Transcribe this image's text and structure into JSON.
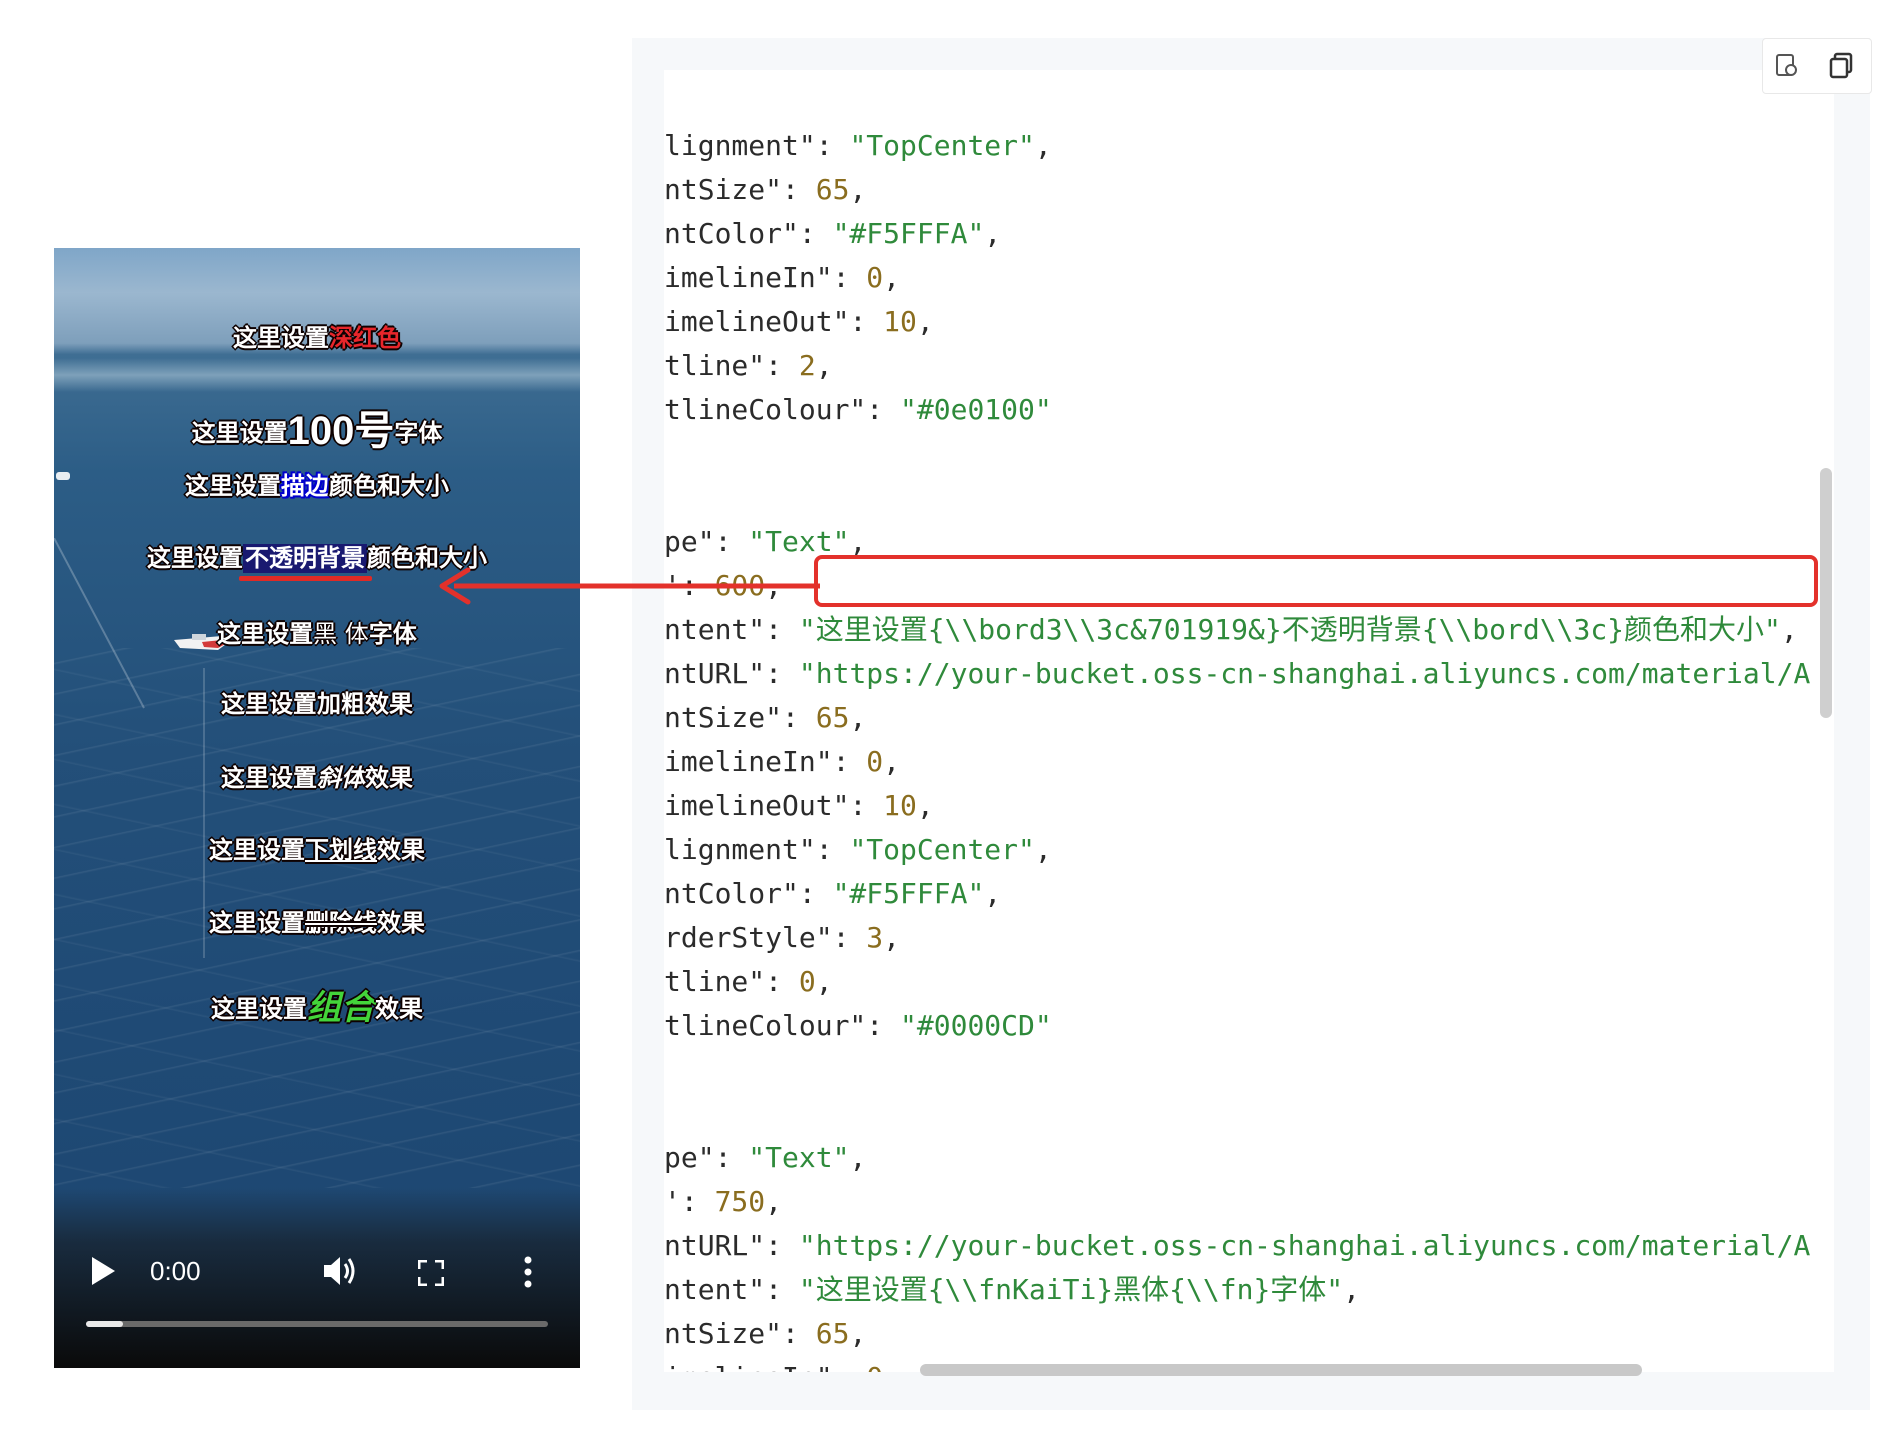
{
  "video": {
    "subtitles": [
      {
        "prefix": "这里设置",
        "highlight": "深红色",
        "suffix": ""
      },
      {
        "prefix": "这里设置",
        "highlight": "100号",
        "suffix": "字体"
      },
      {
        "prefix": "这里设置",
        "highlight": "描边",
        "suffix": "颜色和大小"
      },
      {
        "prefix": "这里设置",
        "highlight": "不透明背景",
        "suffix": "颜色和大小"
      },
      {
        "prefix": "这里设置",
        "highlight": "黑 体",
        "suffix": "字体"
      },
      {
        "prefix": "这里设置",
        "highlight": "加粗",
        "suffix": "效果"
      },
      {
        "prefix": "这里设置",
        "highlight": "斜体",
        "suffix": "效果"
      },
      {
        "prefix": "这里设置",
        "highlight": "下划线",
        "suffix": "效果"
      },
      {
        "prefix": "这里设置",
        "highlight": "删除线",
        "suffix": "效果"
      },
      {
        "prefix": "这里设置",
        "highlight": "组合",
        "suffix": "效果"
      }
    ],
    "controls": {
      "time": "0:00",
      "progress_fraction": 0.08,
      "play_icon": "play-icon",
      "volume_icon": "volume-icon",
      "fullscreen_icon": "fullscreen-icon",
      "more_icon": "more-vertical-icon"
    }
  },
  "code_panel": {
    "toolbar": {
      "refresh_icon": "refresh-icon",
      "copy_icon": "copy-icon"
    },
    "lines": [
      {
        "key": "lignment\"",
        "sep": ": ",
        "value": "\"TopCenter\"",
        "end": ",",
        "vtype": "str"
      },
      {
        "key": "ntSize\"",
        "sep": ": ",
        "value": "65",
        "end": ",",
        "vtype": "num"
      },
      {
        "key": "ntColor\"",
        "sep": ": ",
        "value": "\"#F5FFFA\"",
        "end": ",",
        "vtype": "str"
      },
      {
        "key": "imelineIn\"",
        "sep": ": ",
        "value": "0",
        "end": ",",
        "vtype": "num"
      },
      {
        "key": "imelineOut\"",
        "sep": ": ",
        "value": "10",
        "end": ",",
        "vtype": "num"
      },
      {
        "key": "tline\"",
        "sep": ": ",
        "value": "2",
        "end": ",",
        "vtype": "num"
      },
      {
        "key": "tlineColour\"",
        "sep": ": ",
        "value": "\"#0e0100\"",
        "end": "",
        "vtype": "str"
      },
      {
        "key": "",
        "sep": "",
        "value": "",
        "end": "",
        "vtype": "str"
      },
      {
        "key": "",
        "sep": "",
        "value": "",
        "end": "",
        "vtype": "str"
      },
      {
        "key": "pe\"",
        "sep": ": ",
        "value": "\"Text\"",
        "end": ",",
        "vtype": "str"
      },
      {
        "key": "'",
        "sep": ": ",
        "value": "600",
        "end": ",",
        "vtype": "num"
      },
      {
        "key": "ntent\"",
        "sep": ": ",
        "value": "\"这里设置{\\\\bord3\\\\3c&701919&}不透明背景{\\\\bord\\\\3c}颜色和大小\"",
        "end": ",",
        "vtype": "str"
      },
      {
        "key": "ntURL\"",
        "sep": ": ",
        "value": "\"https://your-bucket.oss-cn-shanghai.aliyuncs.com/material/A",
        "end": "",
        "vtype": "str"
      },
      {
        "key": "ntSize\"",
        "sep": ": ",
        "value": "65",
        "end": ",",
        "vtype": "num"
      },
      {
        "key": "imelineIn\"",
        "sep": ": ",
        "value": "0",
        "end": ",",
        "vtype": "num"
      },
      {
        "key": "imelineOut\"",
        "sep": ": ",
        "value": "10",
        "end": ",",
        "vtype": "num"
      },
      {
        "key": "lignment\"",
        "sep": ": ",
        "value": "\"TopCenter\"",
        "end": ",",
        "vtype": "str"
      },
      {
        "key": "ntColor\"",
        "sep": ": ",
        "value": "\"#F5FFFA\"",
        "end": ",",
        "vtype": "str"
      },
      {
        "key": "rderStyle\"",
        "sep": ": ",
        "value": "3",
        "end": ",",
        "vtype": "num"
      },
      {
        "key": "tline\"",
        "sep": ": ",
        "value": "0",
        "end": ",",
        "vtype": "num"
      },
      {
        "key": "tlineColour\"",
        "sep": ": ",
        "value": "\"#0000CD\"",
        "end": "",
        "vtype": "str"
      },
      {
        "key": "",
        "sep": "",
        "value": "",
        "end": "",
        "vtype": "str"
      },
      {
        "key": "",
        "sep": "",
        "value": "",
        "end": "",
        "vtype": "str"
      },
      {
        "key": "pe\"",
        "sep": ": ",
        "value": "\"Text\"",
        "end": ",",
        "vtype": "str"
      },
      {
        "key": "'",
        "sep": ": ",
        "value": "750",
        "end": ",",
        "vtype": "num"
      },
      {
        "key": "ntURL\"",
        "sep": ": ",
        "value": "\"https://your-bucket.oss-cn-shanghai.aliyuncs.com/material/A",
        "end": "",
        "vtype": "str"
      },
      {
        "key": "ntent\"",
        "sep": ": ",
        "value": "\"这里设置{\\\\fnKaiTi}黑体{\\\\fn}字体\"",
        "end": ",",
        "vtype": "str"
      },
      {
        "key": "ntSize\"",
        "sep": ": ",
        "value": "65",
        "end": ",",
        "vtype": "num"
      },
      {
        "key": "imelineIn\"",
        "sep": ": ",
        "value": "0",
        "end": ",",
        "vtype": "num"
      }
    ]
  },
  "colors": {
    "subtitle_red": "#e8262b",
    "outline_dark": "#0e0100",
    "outline_blue": "#0000CD",
    "box_background": "#191970",
    "green_text": "#43d43a",
    "annotation_red": "#e3312b",
    "code_string": "#2f8a3b",
    "code_key": "#8a6d1f"
  }
}
